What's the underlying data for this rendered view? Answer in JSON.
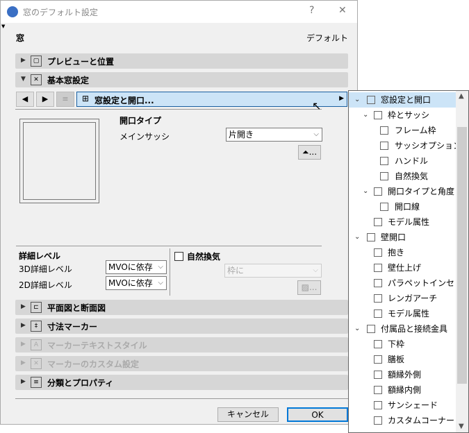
{
  "window": {
    "title": "窓のデフォルト設定",
    "help": "?",
    "close": "✕"
  },
  "header": {
    "left": "窓",
    "right": "デフォルト"
  },
  "sections": {
    "preview": "プレビューと位置",
    "basic": "基本窓設定",
    "plan": "平面図と断面図",
    "dimension": "寸法マーカー",
    "marker_text": "マーカーテキストスタイル",
    "marker_custom": "マーカーのカスタム設定",
    "classification": "分類とプロパティ"
  },
  "nav": {
    "prev": "◀",
    "next": "▶",
    "crumb": "窓設定と開口...",
    "crumb_arrow": "▶"
  },
  "opening": {
    "heading": "開口タイプ",
    "main_sash_label": "メインサッシ",
    "main_sash_value": "片開き",
    "angle_btn": "..."
  },
  "detail": {
    "heading": "詳細レベル",
    "d3_label": "3D詳細レベル",
    "d3_value": "MVOに依存",
    "d2_label": "2D詳細レベル",
    "d2_value": "MVOに依存"
  },
  "vent": {
    "label": "自然換気",
    "checked": false,
    "select_value": "枠に",
    "btn": "..."
  },
  "footer": {
    "cancel": "キャンセル",
    "ok": "OK"
  },
  "tree": [
    {
      "label": "窓設定と開口",
      "level": 0,
      "toggle": true,
      "selected": true
    },
    {
      "label": "枠とサッシ",
      "level": 1,
      "toggle": true
    },
    {
      "label": "フレーム枠",
      "level": 2
    },
    {
      "label": "サッシオプション",
      "level": 2
    },
    {
      "label": "ハンドル",
      "level": 2
    },
    {
      "label": "自然換気",
      "level": 2
    },
    {
      "label": "開口タイプと角度",
      "level": 1,
      "toggle": true
    },
    {
      "label": "開口線",
      "level": 2
    },
    {
      "label": "モデル属性",
      "level": 1
    },
    {
      "label": "壁開口",
      "level": 0,
      "toggle": true
    },
    {
      "label": "抱き",
      "level": 1
    },
    {
      "label": "壁仕上げ",
      "level": 1
    },
    {
      "label": "パラペットインセット",
      "level": 1
    },
    {
      "label": "レンガアーチ",
      "level": 1
    },
    {
      "label": "モデル属性",
      "level": 1
    },
    {
      "label": "付属品と接続金具",
      "level": 0,
      "toggle": true
    },
    {
      "label": "下枠",
      "level": 1
    },
    {
      "label": "膳板",
      "level": 1
    },
    {
      "label": "額縁外側",
      "level": 1
    },
    {
      "label": "額縁内側",
      "level": 1
    },
    {
      "label": "サンシェード",
      "level": 1
    },
    {
      "label": "カスタムコーナー",
      "level": 1
    }
  ]
}
